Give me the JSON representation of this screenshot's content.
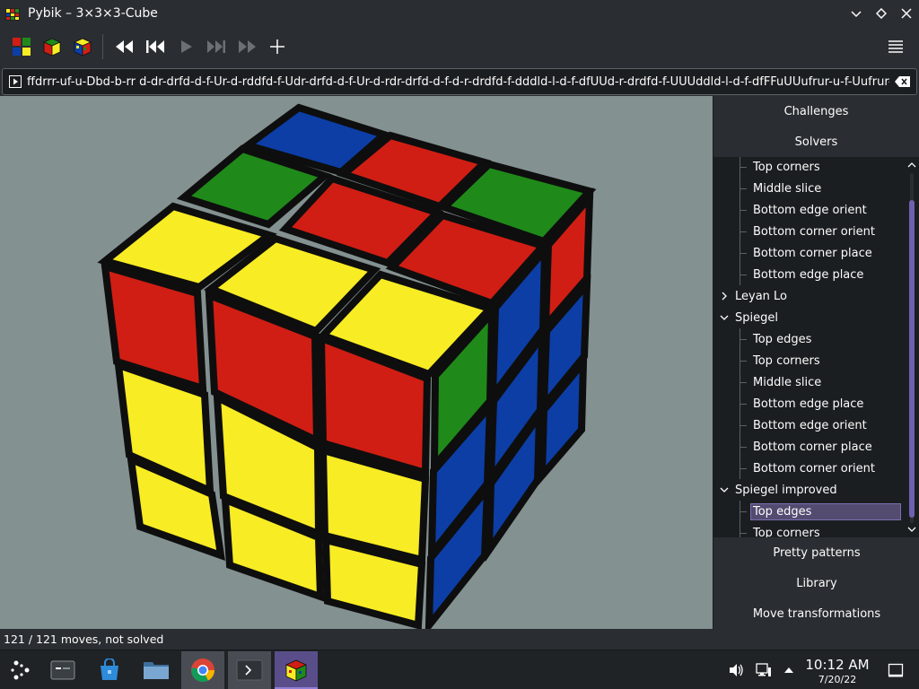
{
  "window": {
    "title": "Pybik – 3×3×3-Cube"
  },
  "moves": {
    "text": "ffdrrr-uf-u-Dbd-b-rr d-dr-drfd-d-f-Ur-d-rddfd-f-Udr-drfd-d-f-Ur-d-rdr-drfd-d-f-d-r-drdfd-f-dddld-l-d-f-dfUUd-r-drdfd-f-UUUddld-l-d-f-dfFFuUUufrur-u-f-Uufrur-u-f-"
  },
  "sidepanel": {
    "challenges": "Challenges",
    "solvers": "Solvers",
    "pretty_patterns": "Pretty patterns",
    "library": "Library",
    "move_transformations": "Move transformations",
    "tree": [
      {
        "label": "Top corners",
        "level": "child"
      },
      {
        "label": "Middle slice",
        "level": "child"
      },
      {
        "label": "Bottom edge orient",
        "level": "child"
      },
      {
        "label": "Bottom corner orient",
        "level": "child"
      },
      {
        "label": "Bottom corner place",
        "level": "child"
      },
      {
        "label": "Bottom edge place",
        "level": "child"
      },
      {
        "label": "Leyan Lo",
        "level": "parent-collapsed"
      },
      {
        "label": "Spiegel",
        "level": "parent-expanded"
      },
      {
        "label": "Top edges",
        "level": "child"
      },
      {
        "label": "Top corners",
        "level": "child"
      },
      {
        "label": "Middle slice",
        "level": "child"
      },
      {
        "label": "Bottom edge place",
        "level": "child"
      },
      {
        "label": "Bottom edge orient",
        "level": "child"
      },
      {
        "label": "Bottom corner place",
        "level": "child"
      },
      {
        "label": "Bottom corner orient",
        "level": "child"
      },
      {
        "label": "Spiegel improved",
        "level": "parent-expanded"
      },
      {
        "label": "Top edges",
        "level": "child",
        "selected": true
      },
      {
        "label": "Top corners",
        "level": "child"
      }
    ]
  },
  "status": {
    "text": "121 / 121 moves, not solved"
  },
  "taskbar": {
    "time": "10:12 AM",
    "date": "7/20/22"
  },
  "colors": {
    "red": "#d01e14",
    "yellow": "#f8ec24",
    "green": "#1f8a1a",
    "blue": "#0c3ea6",
    "background": "#849191",
    "accent": "#6e61b0"
  }
}
